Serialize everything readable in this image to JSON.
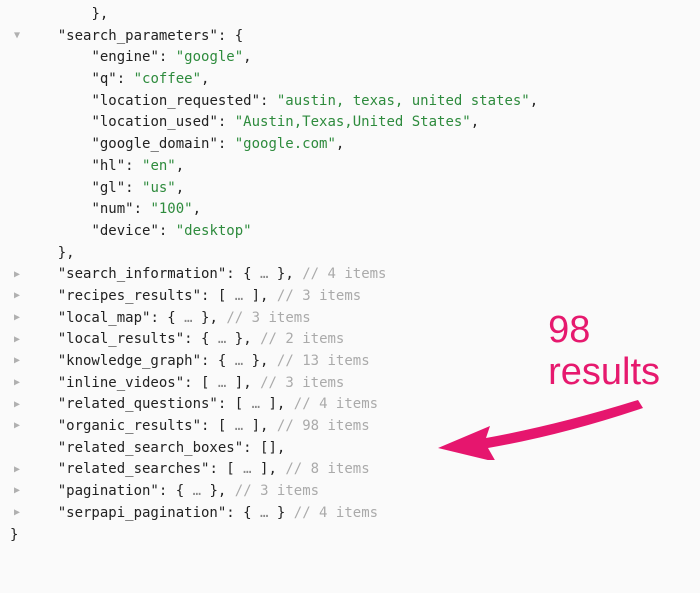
{
  "expanded_key": "search_parameters",
  "params": [
    {
      "key": "engine",
      "value": "google"
    },
    {
      "key": "q",
      "value": "coffee"
    },
    {
      "key": "location_requested",
      "value": "austin, texas, united states"
    },
    {
      "key": "location_used",
      "value": "Austin,Texas,United States"
    },
    {
      "key": "google_domain",
      "value": "google.com"
    },
    {
      "key": "hl",
      "value": "en"
    },
    {
      "key": "gl",
      "value": "us"
    },
    {
      "key": "num",
      "value": "100"
    },
    {
      "key": "device",
      "value": "desktop"
    }
  ],
  "collapsed": [
    {
      "key": "search_information",
      "type": "object",
      "count": "4 items",
      "trailing_comma": true,
      "caret": true
    },
    {
      "key": "recipes_results",
      "type": "array",
      "count": "3 items",
      "trailing_comma": true,
      "caret": true
    },
    {
      "key": "local_map",
      "type": "object",
      "count": "3 items",
      "trailing_comma": true,
      "caret": true
    },
    {
      "key": "local_results",
      "type": "object",
      "count": "2 items",
      "trailing_comma": true,
      "caret": true
    },
    {
      "key": "knowledge_graph",
      "type": "object",
      "count": "13 items",
      "trailing_comma": true,
      "caret": true
    },
    {
      "key": "inline_videos",
      "type": "array",
      "count": "3 items",
      "trailing_comma": true,
      "caret": true
    },
    {
      "key": "related_questions",
      "type": "array",
      "count": "4 items",
      "trailing_comma": true,
      "caret": true
    },
    {
      "key": "organic_results",
      "type": "array",
      "count": "98 items",
      "trailing_comma": true,
      "caret": true
    },
    {
      "key": "related_search_boxes",
      "type": "array_empty",
      "count": "",
      "trailing_comma": true,
      "caret": false
    },
    {
      "key": "related_searches",
      "type": "array",
      "count": "8 items",
      "trailing_comma": true,
      "caret": true
    },
    {
      "key": "pagination",
      "type": "object",
      "count": "3 items",
      "trailing_comma": true,
      "caret": true
    },
    {
      "key": "serpapi_pagination",
      "type": "object",
      "count": "4 items",
      "trailing_comma": false,
      "caret": true
    }
  ],
  "annotation": {
    "line1": "98",
    "line2": "results"
  }
}
